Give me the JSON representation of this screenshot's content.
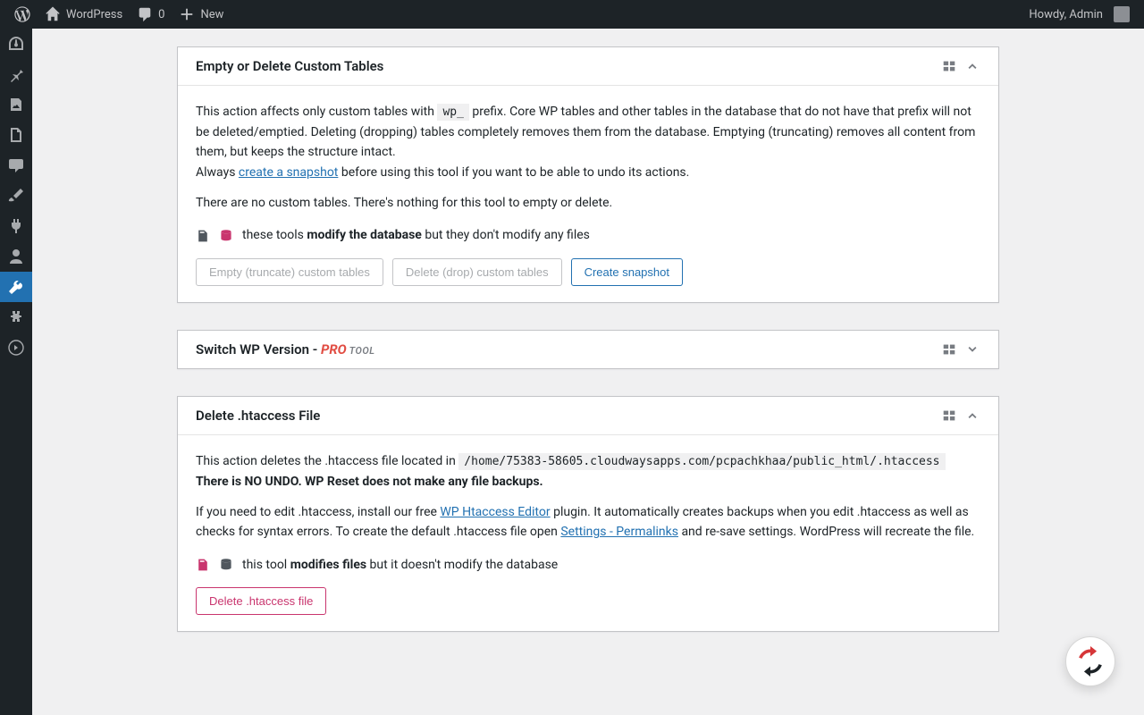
{
  "adminbar": {
    "site": "WordPress",
    "comments": "0",
    "new": "New",
    "howdy": "Howdy, Admin"
  },
  "cards": {
    "empty_tables": {
      "title": "Empty or Delete Custom Tables",
      "p1a": "This action affects only custom tables with ",
      "prefix": "wp_",
      "p1b": " prefix. Core WP tables and other tables in the database that do not have that prefix will not be deleted/emptied. Deleting (dropping) tables completely removes them from the database. Emptying (truncating) removes all content from them, but keeps the structure intact.",
      "always": "Always ",
      "snapshot_link": "create a snapshot",
      "p1c": " before using this tool if you want to be able to undo its actions.",
      "p2": "There are no custom tables. There's nothing for this tool to empty or delete.",
      "mod_a": "these tools ",
      "mod_b": "modify the database",
      "mod_c": " but they don't modify any files",
      "btn_empty": "Empty (truncate) custom tables",
      "btn_delete": "Delete (drop) custom tables",
      "btn_snapshot": "Create snapshot"
    },
    "switch_wp": {
      "title_a": "Switch WP Version - ",
      "pro": "PRO",
      "tool": " TOOL"
    },
    "htaccess": {
      "title": "Delete .htaccess File",
      "p1a": "This action deletes the .htaccess file located in ",
      "path": "/home/75383-58605.cloudwaysapps.com/pcpachkhaa/public_html/.htaccess",
      "no_undo": "There is NO UNDO. WP Reset does not make any file backups.",
      "p2a": "If you need to edit .htaccess, install our free ",
      "editor_link": "WP Htaccess Editor",
      "p2b": " plugin. It automatically creates backups when you edit .htaccess as well as checks for syntax errors. To create the default .htaccess file open ",
      "perma_link": "Settings - Permalinks",
      "p2c": " and re-save settings. WordPress will recreate the file.",
      "mod_a": "this tool ",
      "mod_b": "modifies files",
      "mod_c": " but it doesn't modify the database",
      "btn_delete": "Delete .htaccess file"
    }
  }
}
